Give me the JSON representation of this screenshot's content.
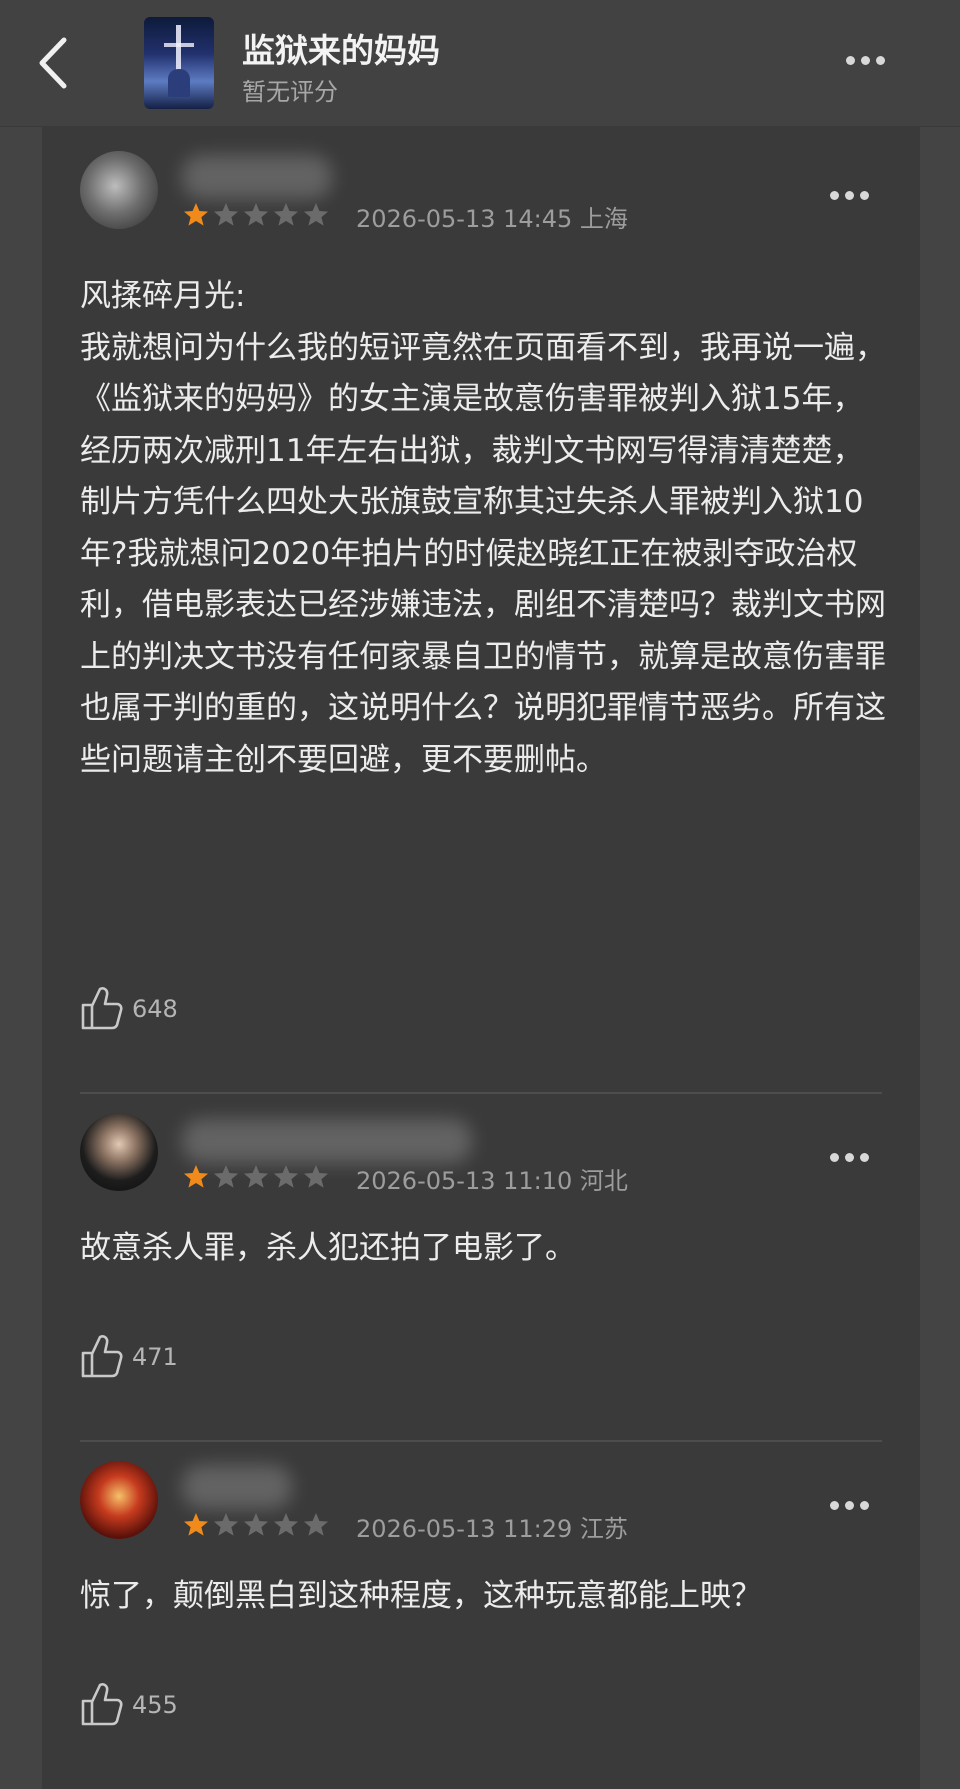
{
  "header": {
    "title": "监狱来的妈妈",
    "subtitle": "暂无评分"
  },
  "comments": [
    {
      "stars_filled": 1,
      "stars_total": 5,
      "meta": "2026-05-13 14:45 上海",
      "text": "风揉碎月光:\n我就想问为什么我的短评竟然在页面看不到，我再说一遍，《监狱来的妈妈》的女主演是故意伤害罪被判入狱15年，经历两次减刑11年左右出狱，裁判文书网写得清清楚楚，制片方凭什么四处大张旗鼓宣称其过失杀人罪被判入狱10年?我就想问2020年拍片的时候赵晓红正在被剥夺政治权利，借电影表达已经涉嫌违法，剧组不清楚吗？裁判文书网上的判决文书没有任何家暴自卫的情节，就算是故意伤害罪也属于判的重的，这说明什么？说明犯罪情节恶劣。所有这些问题请主创不要回避，更不要删帖。",
      "likes": "648"
    },
    {
      "stars_filled": 1,
      "stars_total": 5,
      "meta": "2026-05-13 11:10 河北",
      "text": "故意杀人罪，杀人犯还拍了电影了。",
      "likes": "471"
    },
    {
      "stars_filled": 1,
      "stars_total": 5,
      "meta": "2026-05-13 11:29 江苏",
      "text": "惊了，颠倒黑白到这种程度，这种玩意都能上映？",
      "likes": "455"
    }
  ],
  "icons": {
    "back": "chevron-left-icon",
    "more": "more-dots-icon",
    "like": "thumbs-up-icon",
    "star": "star-icon"
  },
  "colors": {
    "star_filled": "#f08a1a",
    "star_empty": "#6b6b6b",
    "background": "#444444",
    "panel": "#3a3a3a"
  }
}
